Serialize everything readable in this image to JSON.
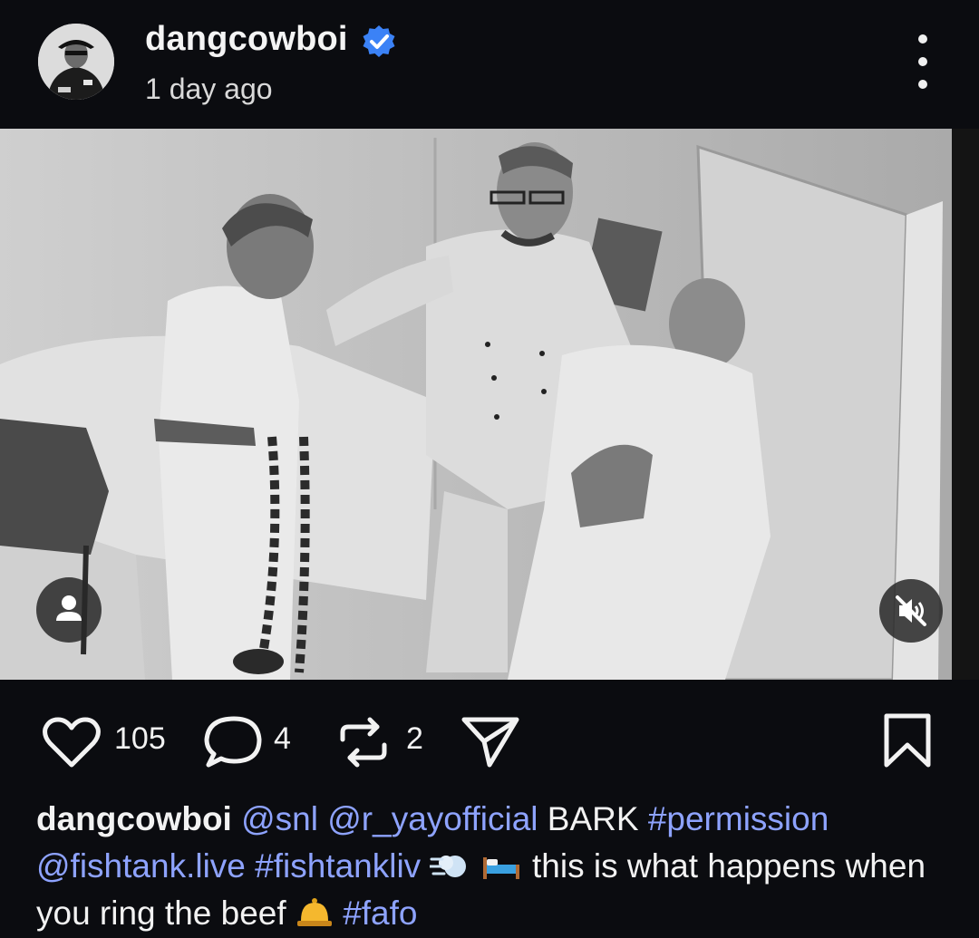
{
  "post": {
    "username": "dangcowboi",
    "verified_icon": "verified-badge-icon",
    "timestamp": "1 day ago",
    "more_icon": "more-options-icon"
  },
  "actions": {
    "likes": "105",
    "comments": "4",
    "reposts": "2"
  },
  "caption": {
    "author": "dangcowboi",
    "mention_1": "@snl",
    "mention_2": "@r_yayofficial",
    "text_1": "BARK",
    "hashtag_1": "#permission",
    "mention_3": "@fishtank.live",
    "hashtag_2": "#fishtankliv",
    "emoji_1": "dash-emoji",
    "emoji_2": "bed-emoji",
    "text_2": "this is what happens when you ring the beef",
    "emoji_3": "bell-emoji",
    "hashtag_3": "#fafo"
  },
  "colors": {
    "link": "#8ea3ff",
    "verified": "#3b82f6",
    "background": "#0b0c10"
  }
}
